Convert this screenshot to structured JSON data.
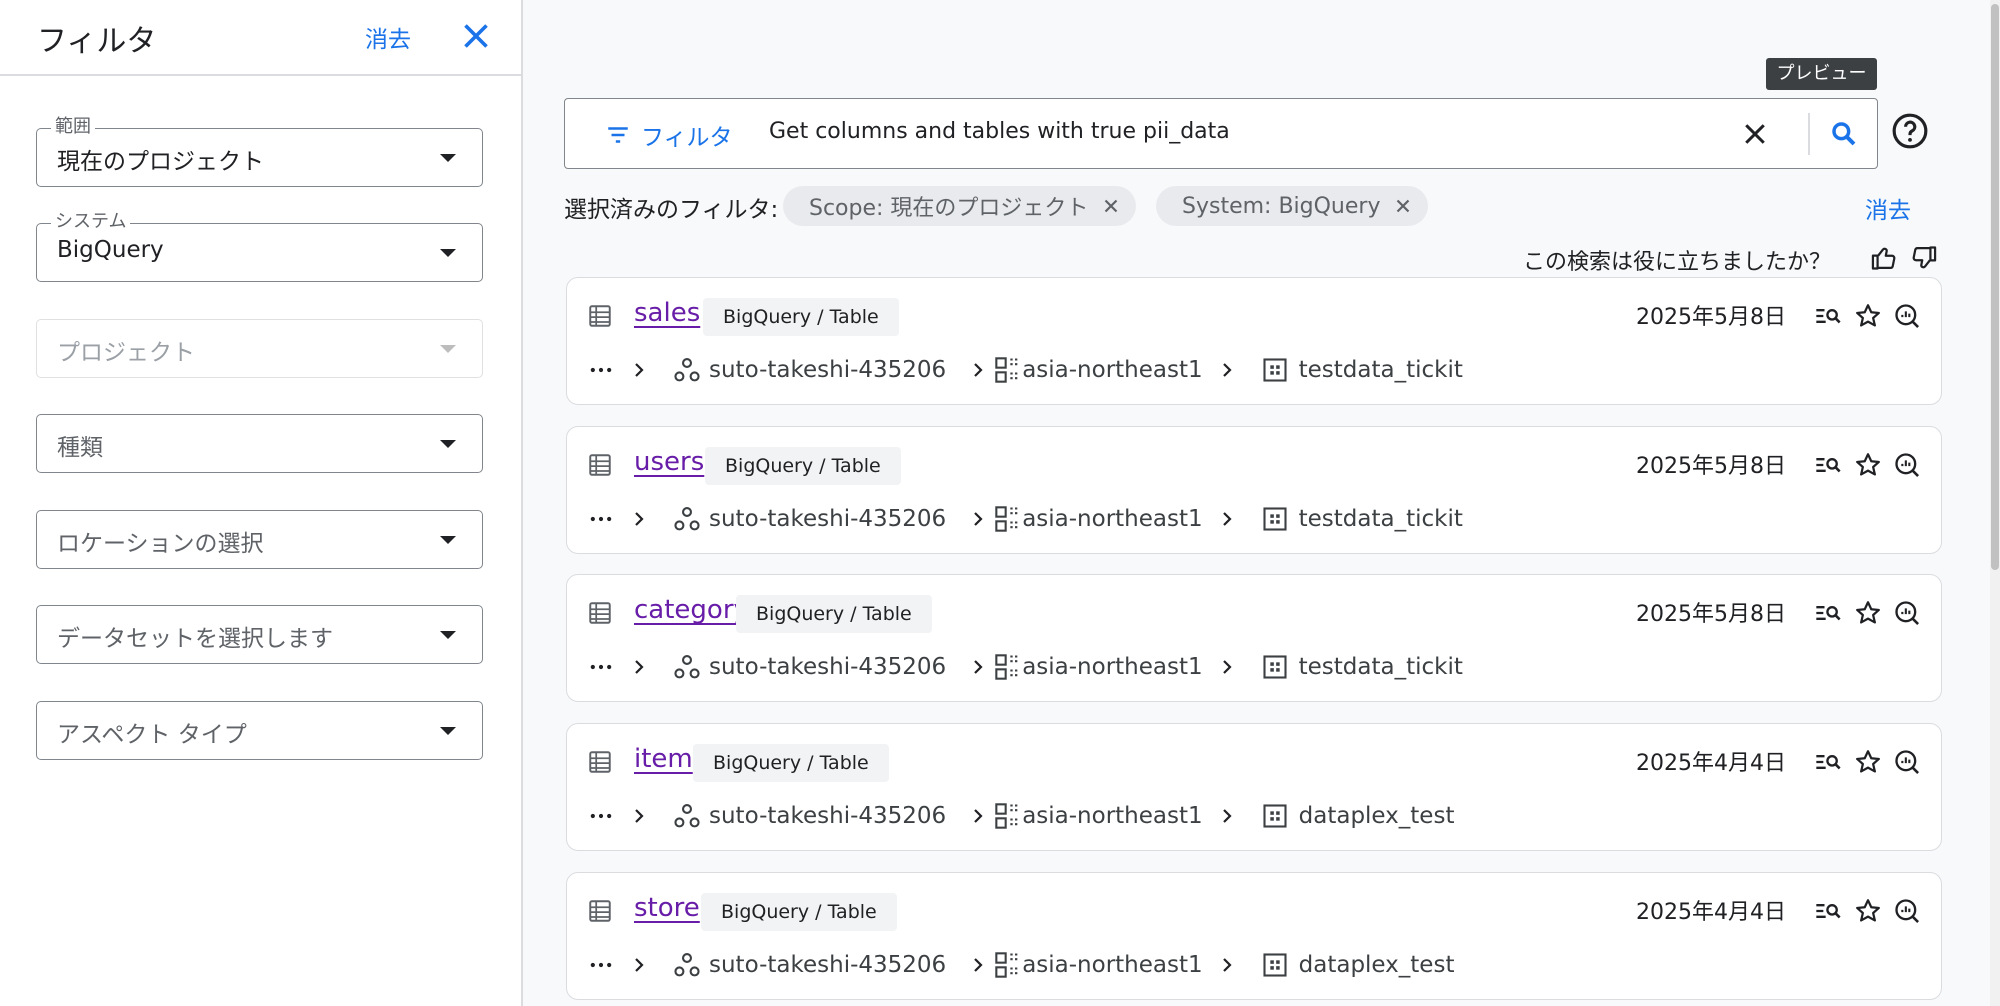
{
  "filter_panel": {
    "title": "フィルタ",
    "clear_label": "消去",
    "fields": [
      {
        "label": "範囲",
        "value": "現在のプロジェクト",
        "placeholder": false
      },
      {
        "label": "システム",
        "value": "BigQuery",
        "placeholder": false
      },
      {
        "label": "",
        "value": "プロジェクト",
        "placeholder": true,
        "disabled": true
      },
      {
        "label": "",
        "value": "種類",
        "placeholder": true
      },
      {
        "label": "",
        "value": "ロケーションの選択",
        "placeholder": true
      },
      {
        "label": "",
        "value": "データセットを選択します",
        "placeholder": true
      },
      {
        "label": "",
        "value": "アスペクト タイプ",
        "placeholder": true
      }
    ]
  },
  "tooltip": "プレビュー",
  "search": {
    "filter_button": "フィルタ",
    "query": "Get columns and tables with true pii_data"
  },
  "selected_filters": {
    "label": "選択済みのフィルタ:",
    "chips": [
      "Scope: 現在のプロジェクト",
      "System: BigQuery"
    ],
    "clear_label": "消去"
  },
  "feedback": {
    "question": "この検索は役に立ちましたか？"
  },
  "results": [
    {
      "name": "sales",
      "badge": "BigQuery / Table",
      "date": "2025年5月8日",
      "project": "suto-takeshi-435206",
      "location": "asia-northeast1",
      "dataset": "testdata_tickit"
    },
    {
      "name": "users",
      "badge": "BigQuery / Table",
      "date": "2025年5月8日",
      "project": "suto-takeshi-435206",
      "location": "asia-northeast1",
      "dataset": "testdata_tickit"
    },
    {
      "name": "category",
      "badge": "BigQuery / Table",
      "date": "2025年5月8日",
      "project": "suto-takeshi-435206",
      "location": "asia-northeast1",
      "dataset": "testdata_tickit"
    },
    {
      "name": "item",
      "badge": "BigQuery / Table",
      "date": "2025年4月4日",
      "project": "suto-takeshi-435206",
      "location": "asia-northeast1",
      "dataset": "dataplex_test"
    },
    {
      "name": "store",
      "badge": "BigQuery / Table",
      "date": "2025年4月4日",
      "project": "suto-takeshi-435206",
      "location": "asia-northeast1",
      "dataset": "dataplex_test"
    }
  ],
  "colors": {
    "accent": "#1a73e8",
    "link_visited": "#681da8",
    "chip_bg": "#e8eaed",
    "tooltip_bg": "#3c4043"
  },
  "icons": [
    "close-icon",
    "filter-list-icon",
    "search-icon",
    "help-icon",
    "thumb-up-icon",
    "thumb-down-icon",
    "table-icon",
    "more-horiz-icon",
    "chevron-right-icon",
    "project-icon",
    "location-icon",
    "dataset-icon",
    "preview-icon",
    "star-icon",
    "insights-icon",
    "caret-down-icon"
  ]
}
